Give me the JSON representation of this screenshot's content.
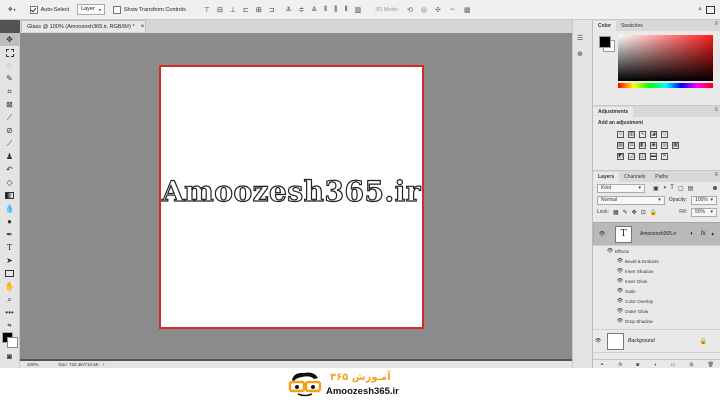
{
  "options_bar": {
    "auto_select_label": "Auto-Select",
    "auto_select_value": "Layer",
    "show_transform_label": "Show Transform Controls",
    "mode_3d_label": "3D Mode:"
  },
  "document": {
    "tab_title": "Glass @ 100% (Amoozesh365.ir, RGB/8#) *",
    "canvas_text": "Amoozesh365.ir",
    "zoom": "100%",
    "doc_info": "Doc: 732.4K/710.6K"
  },
  "color_panel": {
    "tabs": [
      "Color",
      "Swatches"
    ],
    "fg_color": "#000000",
    "bg_color": "#ffffff"
  },
  "adjustments_panel": {
    "title": "Adjustments",
    "subtitle": "Add an adjustment"
  },
  "layers_panel": {
    "tabs": [
      "Layers",
      "Channels",
      "Paths"
    ],
    "filter_kind": "Kind",
    "blend_mode": "Normal",
    "opacity_label": "Opacity:",
    "opacity_value": "100%",
    "lock_label": "Lock:",
    "fill_label": "Fill:",
    "fill_value": "50%",
    "text_layer_name": "Amoozesh365.ir",
    "effects_label": "Effects",
    "effects": [
      "Bevel & Emboss",
      "Inner Shadow",
      "Inner Glow",
      "Satin",
      "Color Overlay",
      "Outer Glow",
      "Drop Shadow"
    ],
    "background_layer_name": "Background"
  },
  "footer": {
    "logo_text": "Amoozesh365.ir",
    "logo_persian": "آمـوزش ۳۶۵"
  }
}
